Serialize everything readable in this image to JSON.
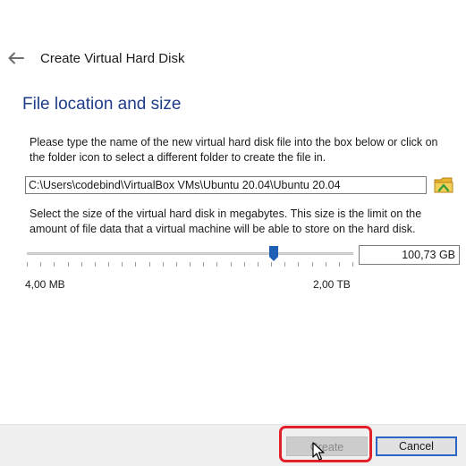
{
  "header": {
    "back_icon": "arrow-left-icon",
    "title": "Create Virtual Hard Disk"
  },
  "section": {
    "title": "File location and size"
  },
  "location": {
    "description": "Please type the name of the new virtual hard disk file into the box below or click on the folder icon to select a different folder to create the file in.",
    "path_value": "C:\\Users\\codebind\\VirtualBox VMs\\Ubuntu 20.04\\Ubuntu 20.04",
    "folder_icon": "folder-icon"
  },
  "size": {
    "description": "Select the size of the virtual hard disk in megabytes. This size is the limit on the amount of file data that a virtual machine will be able to store on the hard disk.",
    "value": "100,73 GB",
    "min_label": "4,00 MB",
    "max_label": "2,00 TB",
    "slider_fraction": 0.755,
    "tick_count": 24
  },
  "footer": {
    "create_label": "Create",
    "create_enabled": false,
    "cancel_label": "Cancel"
  },
  "colors": {
    "section_title": "#1f3c88",
    "slider_thumb": "#1f5fb5",
    "highlight": "#e1202a",
    "cancel_border": "#2b66c7"
  }
}
